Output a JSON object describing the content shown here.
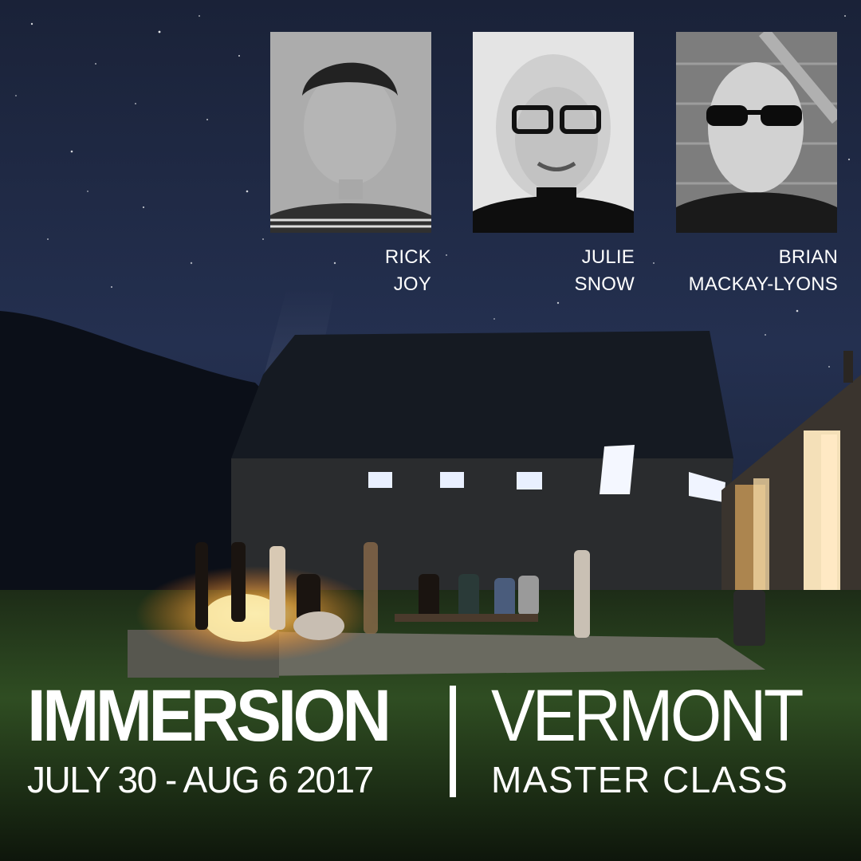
{
  "faculty": [
    {
      "first": "RICK",
      "last": "JOY"
    },
    {
      "first": "JULIE",
      "last": "SNOW"
    },
    {
      "first": "BRIAN",
      "last": "MACKAY-LYONS"
    }
  ],
  "event": {
    "headline": "IMMERSION",
    "dates": "JULY 30 - AUG 6 2017",
    "place": "VERMONT",
    "subtitle": "MASTER CLASS"
  },
  "colors": {
    "sky": "#1c2640",
    "text": "#ffffff",
    "fire": "#ffb347",
    "grass": "#2d4a23"
  }
}
